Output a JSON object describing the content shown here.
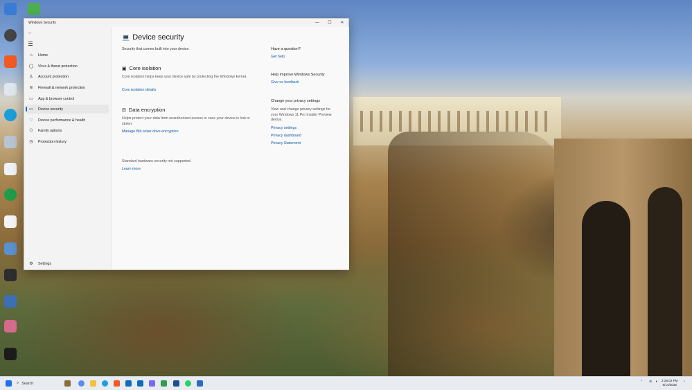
{
  "window": {
    "title": "Windows Security",
    "controls": {
      "minimize": "—",
      "maximize": "☐",
      "close": "✕"
    }
  },
  "sidebar": {
    "back": "←",
    "items": [
      {
        "label": "Home",
        "icon": "home-icon",
        "glyph": "⌂"
      },
      {
        "label": "Virus & threat protection",
        "icon": "shield-icon",
        "glyph": "◯"
      },
      {
        "label": "Account protection",
        "icon": "person-icon",
        "glyph": "♙"
      },
      {
        "label": "Firewall & network protection",
        "icon": "wifi-icon",
        "glyph": "≋"
      },
      {
        "label": "App & browser control",
        "icon": "app-window-icon",
        "glyph": "▭"
      },
      {
        "label": "Device security",
        "icon": "laptop-icon",
        "glyph": "▭"
      },
      {
        "label": "Device performance & health",
        "icon": "heart-icon",
        "glyph": "♡"
      },
      {
        "label": "Family options",
        "icon": "family-icon",
        "glyph": "⚇"
      },
      {
        "label": "Protection history",
        "icon": "history-icon",
        "glyph": "◷"
      }
    ],
    "settings": {
      "label": "Settings",
      "icon": "gear-icon",
      "glyph": "⚙"
    }
  },
  "main": {
    "title": "Device security",
    "subtitle": "Security that comes built into your device.",
    "core_isolation": {
      "title": "Core isolation",
      "text": "Core isolation helps keep your device safe by protecting the Windows kernel.",
      "link": "Core isolation details"
    },
    "data_encryption": {
      "title": "Data encryption",
      "text": "Helps protect your data from unauthorized access in case your device is lost or stolen.",
      "link": "Manage BitLocker drive encryption"
    },
    "hw_status": "Standard hardware security not supported.",
    "learn_more": "Learn more"
  },
  "right_panel": {
    "question_title": "Have a question?",
    "get_help": "Get help",
    "improve_title": "Help improve Windows Security",
    "feedback": "Give us feedback",
    "privacy_title": "Change your privacy settings",
    "privacy_text": "View and change privacy settings for your Windows 11 Pro Insider Preview device.",
    "privacy_settings": "Privacy settings",
    "privacy_dashboard": "Privacy dashboard",
    "privacy_statement": "Privacy Statement"
  },
  "taskbar": {
    "search_placeholder": "Search",
    "time": "2:28:02 PM",
    "date": "6/14/2025"
  },
  "colors": {
    "accent": "#0067c0",
    "link": "#0a5aa8"
  }
}
